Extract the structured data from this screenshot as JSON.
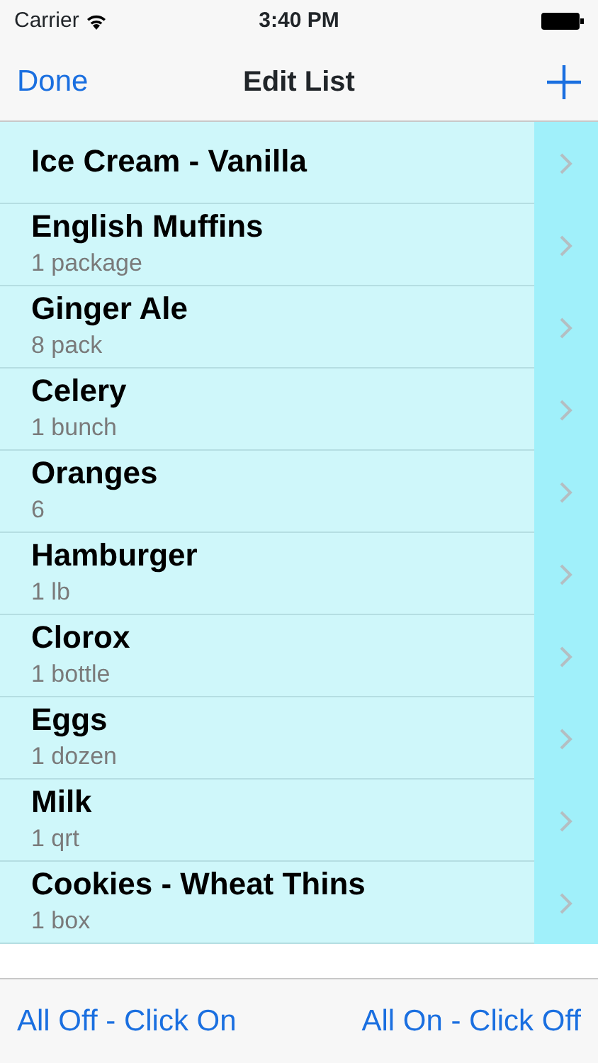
{
  "status_bar": {
    "carrier": "Carrier",
    "time": "3:40 PM"
  },
  "nav_bar": {
    "left_button": "Done",
    "title": "Edit List"
  },
  "items": [
    {
      "name": "Ice Cream - Vanilla"
    },
    {
      "name": "English Muffins",
      "detail": "1 package"
    },
    {
      "name": "Ginger Ale",
      "detail": "8 pack"
    },
    {
      "name": "Celery",
      "detail": "1 bunch"
    },
    {
      "name": "Oranges",
      "detail": "6"
    },
    {
      "name": "Hamburger",
      "detail": "1 lb"
    },
    {
      "name": "Clorox",
      "detail": "1 bottle"
    },
    {
      "name": "Eggs",
      "detail": "1 dozen"
    },
    {
      "name": "Milk",
      "detail": "1 qrt"
    },
    {
      "name": "Cookies - Wheat Thins",
      "detail": "1 box"
    }
  ],
  "toolbar": {
    "left_button": "All Off - Click On",
    "right_button": "All On - Click Off"
  }
}
